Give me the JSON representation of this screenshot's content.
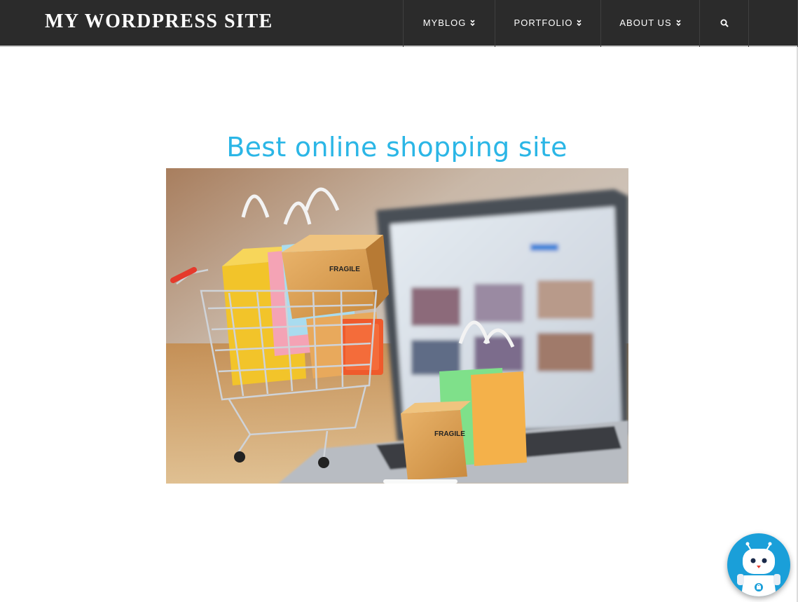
{
  "header": {
    "site_title": "MY WORDPRESS SITE",
    "nav": [
      {
        "label": "MYBLOG",
        "icon": "double-chevron-down-icon"
      },
      {
        "label": "PORTFOLIO",
        "icon": "double-chevron-down-icon"
      },
      {
        "label": "ABOUT US",
        "icon": "double-chevron-down-icon"
      }
    ],
    "search_icon": "search-icon"
  },
  "main": {
    "title": "Best online shopping site",
    "image_labels": [
      "FRAGILE",
      "FRAGILE"
    ]
  },
  "chat_widget": {
    "icon": "robot-icon"
  },
  "colors": {
    "header_bg": "#2b2b2b",
    "title_color": "#2bb6e6",
    "bot_bg": "#1a9fd9"
  }
}
